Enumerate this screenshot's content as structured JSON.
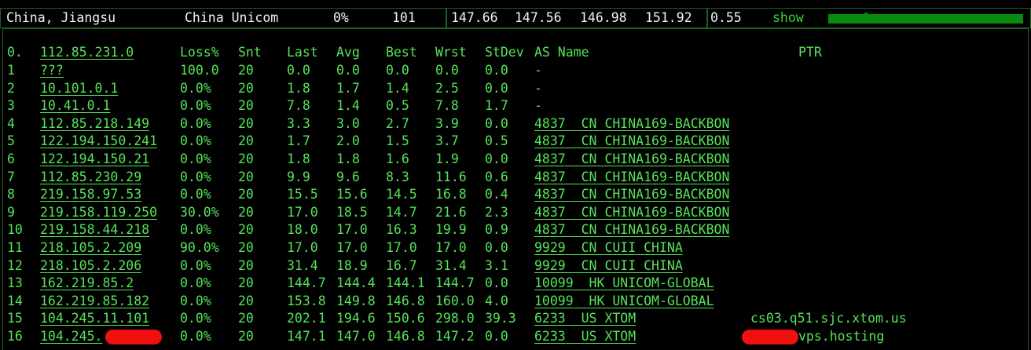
{
  "summary": {
    "location": "China, Jiangsu",
    "isp": "China Unicom",
    "loss": "0%",
    "sent": "101",
    "last": "147.66",
    "avg": "147.56",
    "best": "146.98",
    "worst": "151.92",
    "stdev": "0.55",
    "show_label": "show"
  },
  "header": {
    "idx": "0.",
    "host": "112.85.231.0",
    "loss": "Loss%",
    "snt": "Snt",
    "last": "Last",
    "avg": "Avg",
    "best": "Best",
    "wrst": "Wrst",
    "stdev": "StDev",
    "asname": "AS Name",
    "ptr": "PTR"
  },
  "hops": [
    {
      "idx": "1",
      "host": "???",
      "loss": "100.0",
      "snt": "20",
      "last": "0.0",
      "avg": "0.0",
      "best": "0.0",
      "wrst": "0.0",
      "stdev": "0.0",
      "asn": "-",
      "cc": "",
      "asname": "",
      "ptr": ""
    },
    {
      "idx": "2",
      "host": "10.101.0.1",
      "loss": "0.0%",
      "snt": "20",
      "last": "1.8",
      "avg": "1.7",
      "best": "1.4",
      "wrst": "2.5",
      "stdev": "0.0",
      "asn": "-",
      "cc": "",
      "asname": "",
      "ptr": ""
    },
    {
      "idx": "3",
      "host": "10.41.0.1",
      "loss": "0.0%",
      "snt": "20",
      "last": "7.8",
      "avg": "1.4",
      "best": "0.5",
      "wrst": "7.8",
      "stdev": "1.7",
      "asn": "-",
      "cc": "",
      "asname": "",
      "ptr": ""
    },
    {
      "idx": "4",
      "host": "112.85.218.149",
      "loss": "0.0%",
      "snt": "20",
      "last": "3.3",
      "avg": "3.0",
      "best": "2.7",
      "wrst": "3.9",
      "stdev": "0.0",
      "asn": "4837",
      "cc": "CN",
      "asname": "CHINA169-BACKBON",
      "ptr": ""
    },
    {
      "idx": "5",
      "host": "122.194.150.241",
      "loss": "0.0%",
      "snt": "20",
      "last": "1.7",
      "avg": "2.0",
      "best": "1.5",
      "wrst": "3.7",
      "stdev": "0.5",
      "asn": "4837",
      "cc": "CN",
      "asname": "CHINA169-BACKBON",
      "ptr": ""
    },
    {
      "idx": "6",
      "host": "122.194.150.21",
      "loss": "0.0%",
      "snt": "20",
      "last": "1.8",
      "avg": "1.8",
      "best": "1.6",
      "wrst": "1.9",
      "stdev": "0.0",
      "asn": "4837",
      "cc": "CN",
      "asname": "CHINA169-BACKBON",
      "ptr": ""
    },
    {
      "idx": "7",
      "host": "112.85.230.29",
      "loss": "0.0%",
      "snt": "20",
      "last": "9.9",
      "avg": "9.6",
      "best": "8.3",
      "wrst": "11.6",
      "stdev": "0.6",
      "asn": "4837",
      "cc": "CN",
      "asname": "CHINA169-BACKBON",
      "ptr": ""
    },
    {
      "idx": "8",
      "host": "219.158.97.53",
      "loss": "0.0%",
      "snt": "20",
      "last": "15.5",
      "avg": "15.6",
      "best": "14.5",
      "wrst": "16.8",
      "stdev": "0.4",
      "asn": "4837",
      "cc": "CN",
      "asname": "CHINA169-BACKBON",
      "ptr": ""
    },
    {
      "idx": "9",
      "host": "219.158.119.250",
      "loss": "30.0%",
      "snt": "20",
      "last": "17.0",
      "avg": "18.5",
      "best": "14.7",
      "wrst": "21.6",
      "stdev": "2.3",
      "asn": "4837",
      "cc": "CN",
      "asname": "CHINA169-BACKBON",
      "ptr": ""
    },
    {
      "idx": "10",
      "host": "219.158.44.218",
      "loss": "0.0%",
      "snt": "20",
      "last": "18.0",
      "avg": "17.0",
      "best": "16.3",
      "wrst": "19.9",
      "stdev": "0.9",
      "asn": "4837",
      "cc": "CN",
      "asname": "CHINA169-BACKBON",
      "ptr": ""
    },
    {
      "idx": "11",
      "host": "218.105.2.209",
      "loss": "90.0%",
      "snt": "20",
      "last": "17.0",
      "avg": "17.0",
      "best": "17.0",
      "wrst": "17.0",
      "stdev": "0.0",
      "asn": "9929",
      "cc": "CN",
      "asname": "CUII CHINA",
      "ptr": ""
    },
    {
      "idx": "12",
      "host": "218.105.2.206",
      "loss": "0.0%",
      "snt": "20",
      "last": "31.4",
      "avg": "18.9",
      "best": "16.7",
      "wrst": "31.4",
      "stdev": "3.1",
      "asn": "9929",
      "cc": "CN",
      "asname": "CUII CHINA",
      "ptr": ""
    },
    {
      "idx": "13",
      "host": "162.219.85.2",
      "loss": "0.0%",
      "snt": "20",
      "last": "144.7",
      "avg": "144.4",
      "best": "144.1",
      "wrst": "144.7",
      "stdev": "0.0",
      "asn": "10099",
      "cc": "HK",
      "asname": "UNICOM-GLOBAL",
      "ptr": ""
    },
    {
      "idx": "14",
      "host": "162.219.85.182",
      "loss": "0.0%",
      "snt": "20",
      "last": "153.8",
      "avg": "149.8",
      "best": "146.8",
      "wrst": "160.0",
      "stdev": "4.0",
      "asn": "10099",
      "cc": "HK",
      "asname": "UNICOM-GLOBAL",
      "ptr": ""
    },
    {
      "idx": "15",
      "host": "104.245.11.101",
      "loss": "0.0%",
      "snt": "20",
      "last": "202.1",
      "avg": "194.6",
      "best": "150.6",
      "wrst": "298.0",
      "stdev": "39.3",
      "asn": "6233",
      "cc": "US",
      "asname": "XTOM",
      "ptr": "cs03.q51.sjc.xtom.us"
    },
    {
      "idx": "16",
      "host": "104.245.",
      "loss": "0.0%",
      "snt": "20",
      "last": "147.1",
      "avg": "147.0",
      "best": "146.8",
      "wrst": "147.2",
      "stdev": "0.0",
      "asn": "6233",
      "cc": "US",
      "asname": "XTOM",
      "ptr": "vps.hosting",
      "redacted": true
    }
  ],
  "colors": {
    "background": "#000000",
    "text_green": "#57e35a",
    "show_green": "#36d43a",
    "bar_green": "#0b8a10",
    "redaction": "#f01010"
  }
}
